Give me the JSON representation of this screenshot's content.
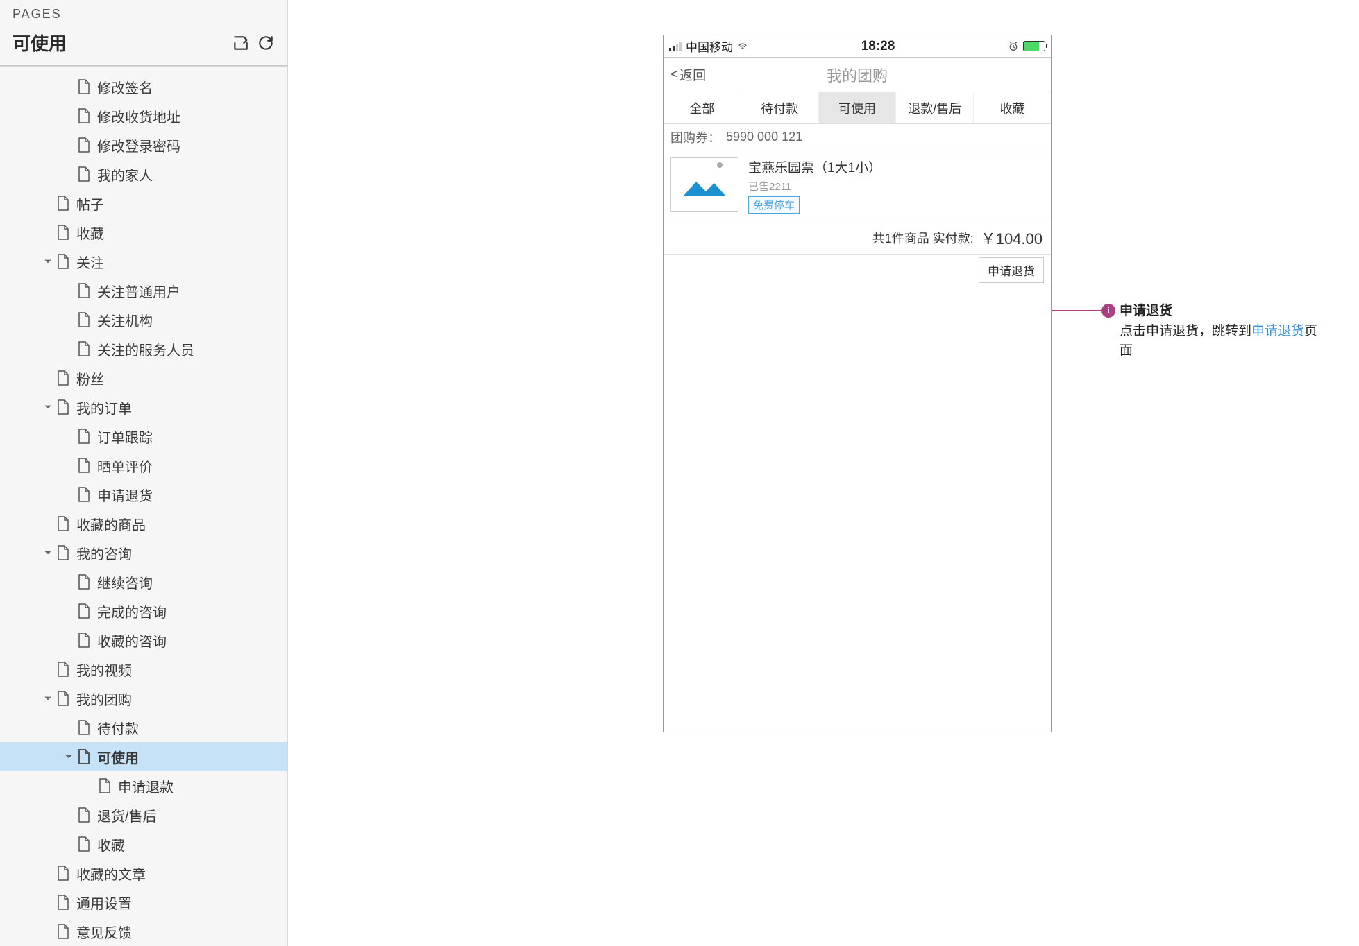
{
  "sidebar": {
    "header": "PAGES",
    "title": "可使用",
    "items": [
      {
        "label": "修改签名",
        "depth": 3,
        "arrow": false
      },
      {
        "label": "修改收货地址",
        "depth": 3,
        "arrow": false
      },
      {
        "label": "修改登录密码",
        "depth": 3,
        "arrow": false
      },
      {
        "label": "我的家人",
        "depth": 3,
        "arrow": false
      },
      {
        "label": "帖子",
        "depth": 2,
        "arrow": false
      },
      {
        "label": "收藏",
        "depth": 2,
        "arrow": false
      },
      {
        "label": "关注",
        "depth": 2,
        "arrow": true
      },
      {
        "label": "关注普通用户",
        "depth": 3,
        "arrow": false
      },
      {
        "label": "关注机构",
        "depth": 3,
        "arrow": false
      },
      {
        "label": "关注的服务人员",
        "depth": 3,
        "arrow": false
      },
      {
        "label": "粉丝",
        "depth": 2,
        "arrow": false
      },
      {
        "label": "我的订单",
        "depth": 2,
        "arrow": true
      },
      {
        "label": "订单跟踪",
        "depth": 3,
        "arrow": false
      },
      {
        "label": "晒单评价",
        "depth": 3,
        "arrow": false
      },
      {
        "label": "申请退货",
        "depth": 3,
        "arrow": false
      },
      {
        "label": "收藏的商品",
        "depth": 2,
        "arrow": false
      },
      {
        "label": "我的咨询",
        "depth": 2,
        "arrow": true
      },
      {
        "label": "继续咨询",
        "depth": 3,
        "arrow": false
      },
      {
        "label": "完成的咨询",
        "depth": 3,
        "arrow": false
      },
      {
        "label": "收藏的咨询",
        "depth": 3,
        "arrow": false
      },
      {
        "label": "我的视频",
        "depth": 2,
        "arrow": false
      },
      {
        "label": "我的团购",
        "depth": 2,
        "arrow": true
      },
      {
        "label": "待付款",
        "depth": 3,
        "arrow": false
      },
      {
        "label": "可使用",
        "depth": 3,
        "arrow": true,
        "selected": true
      },
      {
        "label": "申请退款",
        "depth": 4,
        "arrow": false
      },
      {
        "label": "退货/售后",
        "depth": 3,
        "arrow": false
      },
      {
        "label": "收藏",
        "depth": 3,
        "arrow": false
      },
      {
        "label": "收藏的文章",
        "depth": 2,
        "arrow": false
      },
      {
        "label": "通用设置",
        "depth": 2,
        "arrow": false
      },
      {
        "label": "意见反馈",
        "depth": 2,
        "arrow": false
      }
    ]
  },
  "phone": {
    "status": {
      "carrier": "中国移动",
      "time": "18:28"
    },
    "nav": {
      "back": "返回",
      "title": "我的团购"
    },
    "tabs": [
      "全部",
      "待付款",
      "可使用",
      "退款/售后",
      "收藏"
    ],
    "active_tab": 2,
    "coupon_label": "团购券：",
    "coupon_value": "5990 000 121",
    "product": {
      "name": "宝燕乐园票（1大1小）",
      "sold": "已售2211",
      "tag": "免费停车"
    },
    "summary": {
      "text": "共1件商品 实付款:",
      "price": "￥104.00"
    },
    "refund_btn": "申请退货"
  },
  "annotation": {
    "title": "申请退货",
    "text_before": "点击申请退货，跳转到",
    "link": "申请退货",
    "text_after": "页面"
  }
}
